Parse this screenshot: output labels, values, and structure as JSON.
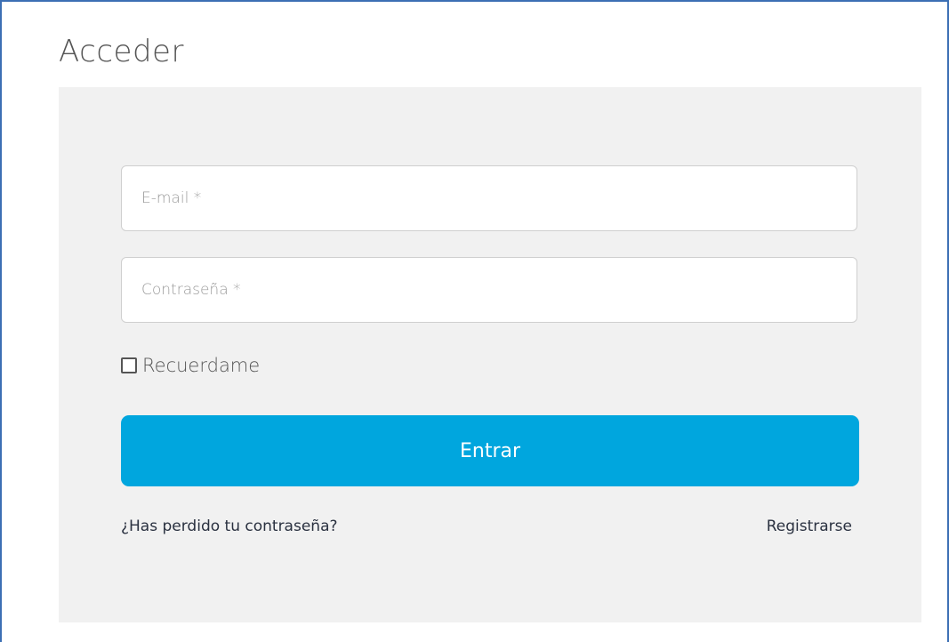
{
  "page": {
    "title": "Acceder"
  },
  "form": {
    "email_placeholder": "E-mail *",
    "password_placeholder": "Contraseña *",
    "remember_label": "Recuerdame",
    "remember_checked": false,
    "submit_label": "Entrar",
    "forgot_password_link": "¿Has perdido tu contraseña?",
    "register_link": "Registrarse"
  },
  "colors": {
    "accent": "#00a6de",
    "panel_background": "#f1f1f1",
    "frame": "#3c6fb4"
  }
}
